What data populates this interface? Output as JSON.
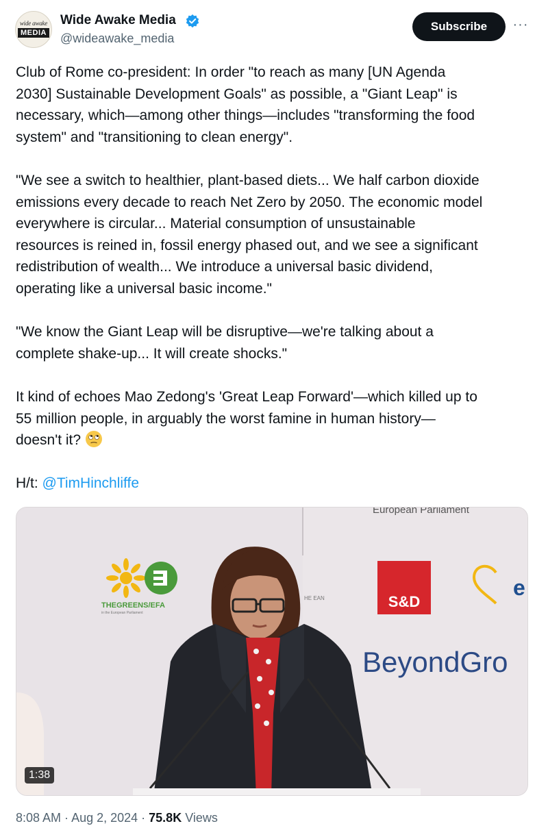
{
  "author": {
    "name": "Wide Awake Media",
    "handle": "@wideawake_media",
    "avatar_text_top": "wide awake",
    "avatar_text_main": "MEDIA",
    "verified": true
  },
  "actions": {
    "subscribe_label": "Subscribe",
    "more_label": "···"
  },
  "tweet": {
    "paragraph_1": "Club of Rome co-president: In order \"to reach as many [UN Agenda\n2030] Sustainable Development Goals\" as possible, a \"Giant Leap\" is\nnecessary, which—among other things—includes \"transforming the food\nsystem\" and \"transitioning to clean energy\".",
    "paragraph_2": "\"We see a switch to healthier, plant-based diets... We half carbon dioxide\nemissions every decade to reach Net Zero by 2050. The economic model\neverywhere is circular... Material consumption of unsustainable\nresources is reined in, fossil energy phased out, and we see a significant\nredistribution of wealth... We introduce a universal basic dividend,\noperating like a universal basic income.\"",
    "paragraph_3": "\"We know the Giant Leap will be disruptive—we're talking about a\ncomplete shake-up... It will create shocks.\"",
    "paragraph_4": "It kind of echoes Mao Zedong's 'Great Leap Forward'—which killed up to\n55 million people, in arguably the worst famine in human history—\ndoesn't it?",
    "ht_prefix": "H/t: ",
    "ht_mention": "@TimHinchliffe"
  },
  "media": {
    "duration": "1:38",
    "backdrop_text_top": "European Parliament",
    "logo_greens": "THEGREENS/EFA",
    "logo_greens_sub": "in the European Parliament",
    "logo_sd": "S&D",
    "logo_e": "e",
    "backdrop_text_beyond": "BeyondGro",
    "backdrop_small": "HE EAN"
  },
  "meta": {
    "time": "8:08 AM",
    "sep1": " · ",
    "date": "Aug 2, 2024",
    "sep2": " · ",
    "views_count": "75.8K",
    "views_label": " Views"
  },
  "colors": {
    "link": "#1d9bf0",
    "text": "#0f1419",
    "secondary": "#536471",
    "verified": "#1d9bf0",
    "sd_red": "#d6262c",
    "greens_green": "#4a9a3b",
    "greens_yellow": "#f2b713"
  },
  "icons": {
    "verified": "verified-badge-icon",
    "more": "more-horizontal-icon",
    "emoji": "face-with-rolling-eyes-emoji"
  }
}
